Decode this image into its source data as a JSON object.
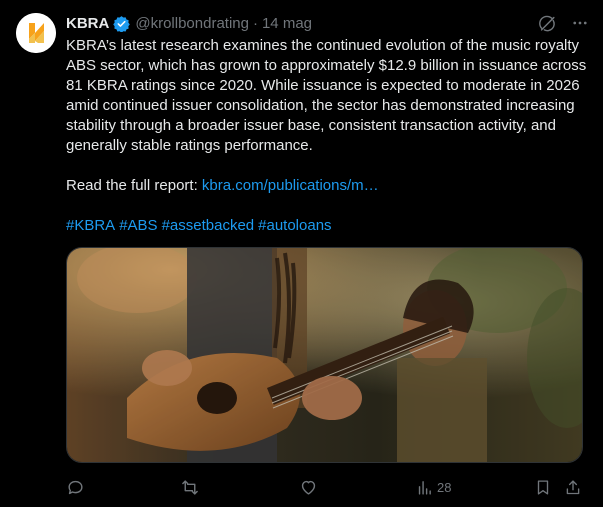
{
  "post": {
    "author": {
      "name": "KBRA",
      "handle": "@krollbondrating",
      "separator": "·",
      "date": "14 mag",
      "verified": true,
      "avatar": "kbra-logo"
    },
    "text": {
      "paragraph1": "KBRA’s latest research examines the continued evolution of the music royalty ABS sector, which has grown to approximately $12.9 billion in issuance across 81 KBRA ratings since 2020. While issuance is expected to moderate in 2026 amid continued issuer consolidation, the sector has demonstrated increasing stability through a broader issuer base, consistent transaction activity, and generally stable ratings performance.",
      "read_more_label": "Read the full report: ",
      "link_text": "kbra.com/publications/m…",
      "hashtags": [
        "#KBRA",
        "#ABS",
        "#assetbacked",
        "#autoloans"
      ]
    },
    "media": {
      "description_icon": "photo-guitarists"
    },
    "actions": {
      "reply_icon": "reply-icon",
      "repost_icon": "repost-icon",
      "like_icon": "like-icon",
      "views_icon": "views-icon",
      "views_count": "28",
      "bookmark_icon": "bookmark-icon",
      "share_icon": "share-icon"
    },
    "header_actions": {
      "grok_icon": "grok-icon",
      "more_icon": "more-icon"
    },
    "colors": {
      "background": "#000000",
      "text": "#e7e9ea",
      "secondary": "#71767b",
      "accent": "#1d9bf0",
      "brand": "#f7a21b"
    }
  }
}
